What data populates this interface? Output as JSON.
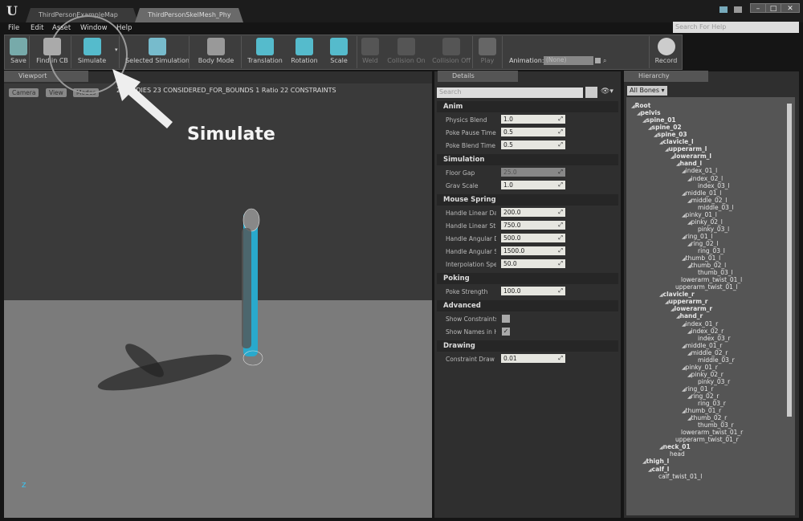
{
  "tabs": [
    "ThirdPersonExampleMap",
    "ThirdPersonSkelMesh_Phy"
  ],
  "help_search_placeholder": "Search For Help",
  "menu": [
    "File",
    "Edit",
    "Asset",
    "Window",
    "Help"
  ],
  "toolbar": [
    {
      "label": "Save"
    },
    {
      "label": "Find in CB"
    },
    {
      "label": "Simulate"
    },
    {
      "label": "Selected Simulation"
    },
    {
      "label": "Body Mode"
    },
    {
      "label": "Translation"
    },
    {
      "label": "Rotation"
    },
    {
      "label": "Scale"
    },
    {
      "label": "Weld"
    },
    {
      "label": "Collision On"
    },
    {
      "label": "Collision Off"
    },
    {
      "label": "Play"
    },
    {
      "label": "Record"
    }
  ],
  "animation": {
    "label": "Animation:",
    "value": "(None)"
  },
  "viewport": {
    "tab": "Viewport",
    "buttons": [
      "Camera",
      "View",
      "Modes"
    ],
    "stats": "23 BODIES 23 CONSIDERED_FOR_BOUNDS  1 Ratio  22 CONSTRAINTS",
    "axis": "Z"
  },
  "annotation": "Simulate",
  "details": {
    "tab": "Details",
    "search_placeholder": "Search",
    "sections": [
      {
        "title": "Anim",
        "rows": [
          {
            "label": "Physics Blend",
            "value": "1.0"
          },
          {
            "label": "Poke Pause Time",
            "value": "0.5"
          },
          {
            "label": "Poke Blend Time",
            "value": "0.5"
          }
        ]
      },
      {
        "title": "Simulation",
        "rows": [
          {
            "label": "Floor Gap",
            "value": "25.0",
            "disabled": true
          },
          {
            "label": "Grav Scale",
            "value": "1.0"
          }
        ]
      },
      {
        "title": "Mouse Spring",
        "rows": [
          {
            "label": "Handle Linear Damping",
            "value": "200.0"
          },
          {
            "label": "Handle Linear Stiffness",
            "value": "750.0"
          },
          {
            "label": "Handle Angular Damping",
            "value": "500.0"
          },
          {
            "label": "Handle Angular Stiffness",
            "value": "1500.0"
          },
          {
            "label": "Interpolation Speed",
            "value": "50.0"
          }
        ]
      },
      {
        "title": "Poking",
        "rows": [
          {
            "label": "Poke Strength",
            "value": "100.0"
          }
        ]
      },
      {
        "title": "Advanced",
        "rows": [
          {
            "label": "Show Constraints",
            "checked": false
          },
          {
            "label": "Show Names in Hierarchy",
            "checked": true
          }
        ]
      },
      {
        "title": "Drawing",
        "rows": [
          {
            "label": "Constraint Draw Size",
            "value": "0.01"
          }
        ]
      }
    ]
  },
  "hierarchy": {
    "tab": "Hierarchy",
    "filter": "All Bones",
    "items": [
      [
        "Root",
        0,
        1
      ],
      [
        "pelvis",
        1,
        1
      ],
      [
        "spine_01",
        2,
        1
      ],
      [
        "spine_02",
        3,
        1
      ],
      [
        "spine_03",
        4,
        1
      ],
      [
        "clavicle_l",
        5,
        1
      ],
      [
        "upperarm_l",
        6,
        1
      ],
      [
        "lowerarm_l",
        7,
        1
      ],
      [
        "hand_l",
        8,
        1
      ],
      [
        "index_01_l",
        9,
        1
      ],
      [
        "index_02_l",
        10,
        1
      ],
      [
        "index_03_l",
        11,
        0
      ],
      [
        "middle_01_l",
        9,
        1
      ],
      [
        "middle_02_l",
        10,
        1
      ],
      [
        "middle_03_l",
        11,
        0
      ],
      [
        "pinky_01_l",
        9,
        1
      ],
      [
        "pinky_02_l",
        10,
        1
      ],
      [
        "pinky_03_l",
        11,
        0
      ],
      [
        "ring_01_l",
        9,
        1
      ],
      [
        "ring_02_l",
        10,
        1
      ],
      [
        "ring_03_l",
        11,
        0
      ],
      [
        "thumb_01_l",
        9,
        1
      ],
      [
        "thumb_02_l",
        10,
        1
      ],
      [
        "thumb_03_l",
        11,
        0
      ],
      [
        "lowerarm_twist_01_l",
        8,
        0
      ],
      [
        "upperarm_twist_01_l",
        7,
        0
      ],
      [
        "clavicle_r",
        5,
        1
      ],
      [
        "upperarm_r",
        6,
        1
      ],
      [
        "lowerarm_r",
        7,
        1
      ],
      [
        "hand_r",
        8,
        1
      ],
      [
        "index_01_r",
        9,
        1
      ],
      [
        "index_02_r",
        10,
        1
      ],
      [
        "index_03_r",
        11,
        0
      ],
      [
        "middle_01_r",
        9,
        1
      ],
      [
        "middle_02_r",
        10,
        1
      ],
      [
        "middle_03_r",
        11,
        0
      ],
      [
        "pinky_01_r",
        9,
        1
      ],
      [
        "pinky_02_r",
        10,
        1
      ],
      [
        "pinky_03_r",
        11,
        0
      ],
      [
        "ring_01_r",
        9,
        1
      ],
      [
        "ring_02_r",
        10,
        1
      ],
      [
        "ring_03_r",
        11,
        0
      ],
      [
        "thumb_01_r",
        9,
        1
      ],
      [
        "thumb_02_r",
        10,
        1
      ],
      [
        "thumb_03_r",
        11,
        0
      ],
      [
        "lowerarm_twist_01_r",
        8,
        0
      ],
      [
        "upperarm_twist_01_r",
        7,
        0
      ],
      [
        "neck_01",
        5,
        1
      ],
      [
        "head",
        6,
        0
      ],
      [
        "thigh_l",
        2,
        1
      ],
      [
        "calf_l",
        3,
        1
      ],
      [
        "calf_twist_01_l",
        4,
        0
      ]
    ]
  },
  "colors": {
    "accent": "#3fb6d8"
  }
}
